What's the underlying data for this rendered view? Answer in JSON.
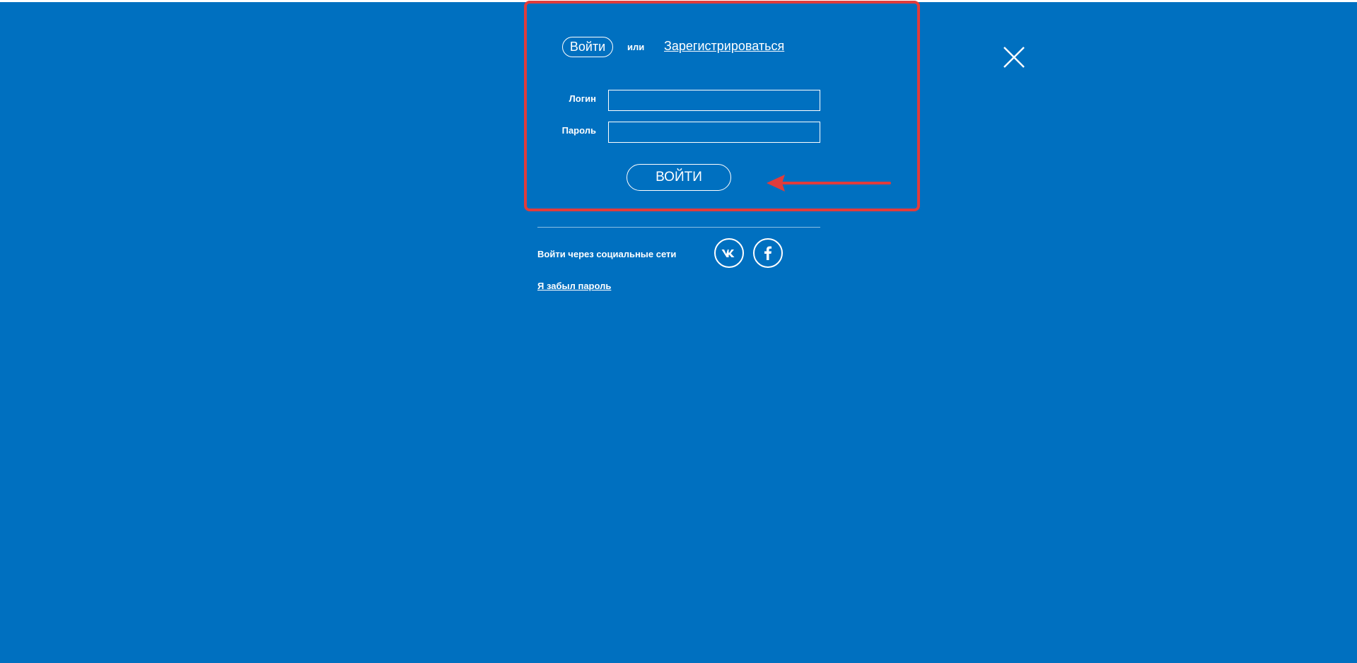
{
  "auth": {
    "tab_login": "Войти",
    "tab_separator": "или",
    "tab_register": "Зарегистрироваться"
  },
  "form": {
    "login_label": "Логин",
    "password_label": "Пароль",
    "login_value": "",
    "password_value": "",
    "submit_label": "ВОЙТИ"
  },
  "social": {
    "label": "Войти через социальные сети",
    "icons": [
      "vk-icon",
      "facebook-icon"
    ]
  },
  "forgot_password": "Я забыл пароль",
  "colors": {
    "background": "#0070c0",
    "foreground": "#ffffff",
    "annotation": "#e03c3c"
  }
}
